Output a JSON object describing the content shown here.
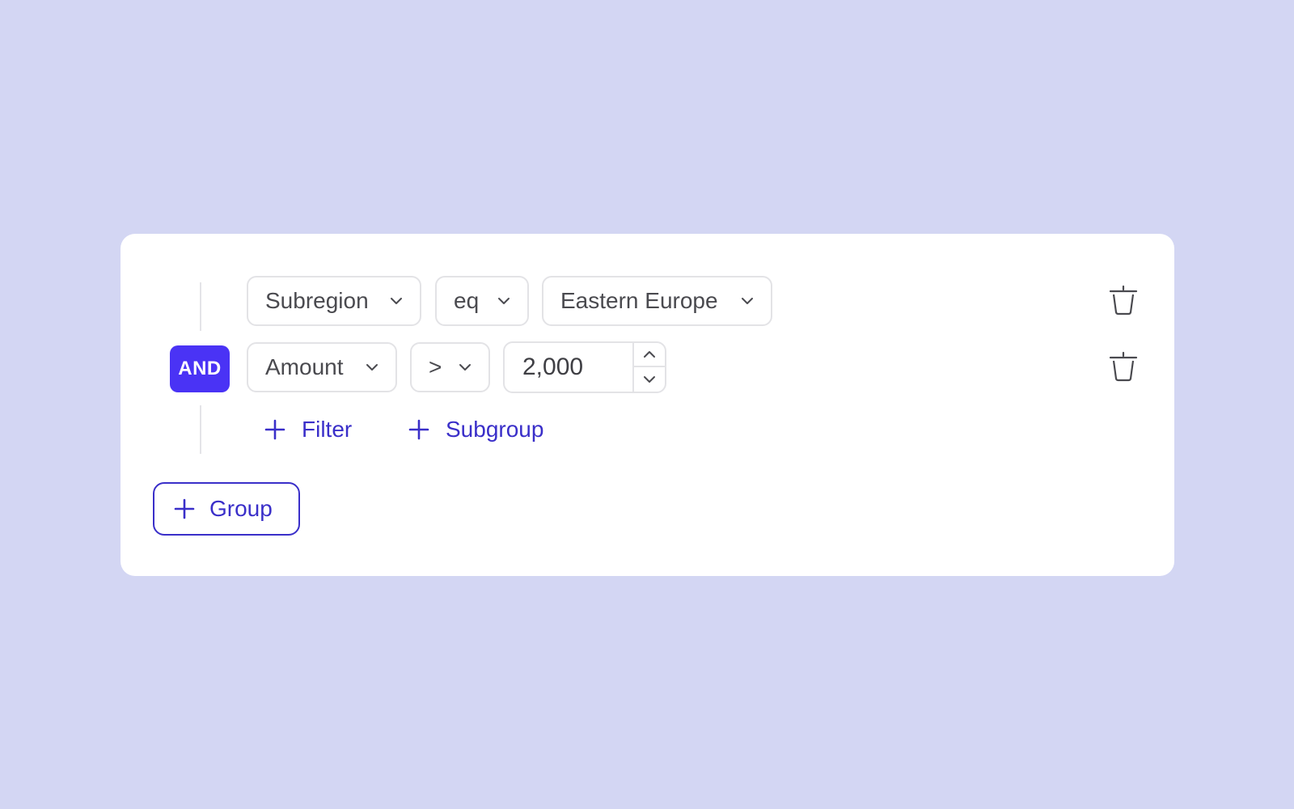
{
  "colors": {
    "accent": "#4a33f5",
    "link": "#3a2fc9",
    "background": "#d3d6f3",
    "card": "#ffffff"
  },
  "logic": {
    "operator_label": "AND"
  },
  "filters": [
    {
      "field": "Subregion",
      "operator": "eq",
      "value": "Eastern Europe"
    },
    {
      "field": "Amount",
      "operator": ">",
      "value": "2,000"
    }
  ],
  "actions": {
    "add_filter": "Filter",
    "add_subgroup": "Subgroup",
    "add_group": "Group"
  },
  "icons": {
    "dropdown": "chevron-down-icon",
    "delete": "trash-icon",
    "add": "plus-icon",
    "stepper_up": "chevron-up-icon",
    "stepper_down": "chevron-down-icon"
  }
}
